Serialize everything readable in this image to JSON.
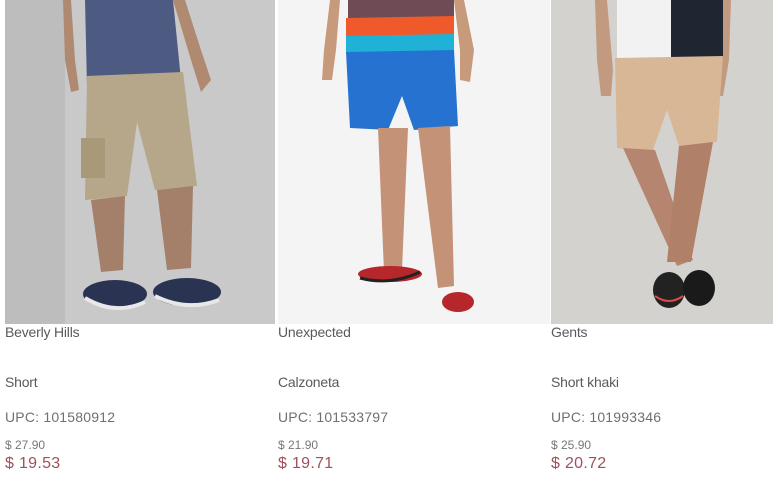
{
  "products": [
    {
      "image": "product-photo-cargo-shorts",
      "brand": "Beverly Hills",
      "name": "Short",
      "upc": "UPC: 101580912",
      "old_price": "$ 27.90",
      "new_price": "$ 19.53"
    },
    {
      "image": "product-photo-swim-shorts",
      "brand": "Unexpected",
      "name": "Calzoneta",
      "upc": "UPC: 101533797",
      "old_price": "$ 21.90",
      "new_price": "$ 19.71"
    },
    {
      "image": "product-photo-khaki-shorts",
      "brand": "Gents",
      "name": "Short khaki",
      "upc": "UPC: 101993346",
      "old_price": "$ 25.90",
      "new_price": "$ 20.72"
    }
  ],
  "colors": {
    "sale_price": "#a0505a",
    "text": "#5a5a5a"
  }
}
